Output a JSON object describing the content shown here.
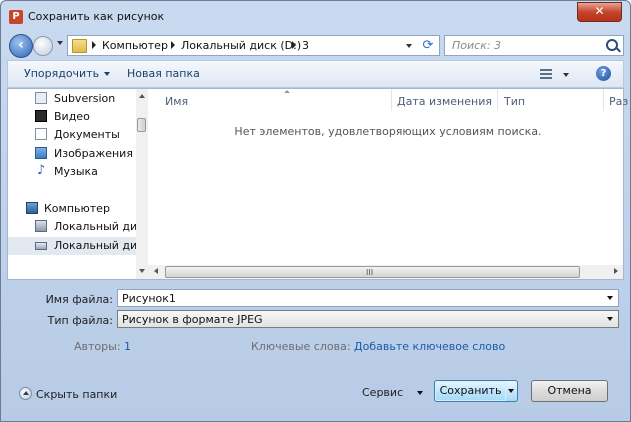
{
  "window": {
    "title": "Сохранить как рисунок",
    "app_icon": "P",
    "close_glyph": "✕"
  },
  "address": {
    "crumbs": [
      "Компьютер",
      "Локальный диск (D:)",
      "3"
    ]
  },
  "search": {
    "placeholder": "Поиск: 3"
  },
  "toolbar": {
    "organize_label": "Упорядочить",
    "new_folder_label": "Новая папка",
    "help_glyph": "?"
  },
  "nav": {
    "items": [
      {
        "label": "Subversion",
        "icon": "subversion-icon"
      },
      {
        "label": "Видео",
        "icon": "video-icon"
      },
      {
        "label": "Документы",
        "icon": "documents-icon"
      },
      {
        "label": "Изображения",
        "icon": "pictures-icon"
      },
      {
        "label": "Музыка",
        "icon": "music-icon"
      },
      {
        "label": "Компьютер",
        "icon": "computer-icon"
      },
      {
        "label": "Локальный диск",
        "icon": "drive-c-icon"
      },
      {
        "label": "Локальный диск",
        "icon": "drive-d-icon",
        "selected": true
      }
    ]
  },
  "columns": [
    "Имя",
    "Дата изменения",
    "Тип",
    "Раз"
  ],
  "empty_message": "Нет элементов, удовлетворяющих условиям поиска.",
  "scrollbar_grip": "III",
  "form": {
    "filename_label": "Имя файла:",
    "filename_value": "Рисунок1",
    "filetype_label": "Тип файла:",
    "filetype_value": "Рисунок в формате JPEG",
    "authors_label": "Авторы:",
    "authors_value": "1",
    "keywords_label": "Ключевые слова:",
    "keywords_value": "Добавьте ключевое слово"
  },
  "footer": {
    "hide_folders_label": "Скрыть папки",
    "service_label": "Сервис",
    "save_label": "Сохранить",
    "cancel_label": "Отмена"
  },
  "colors": {
    "accent": "#1f5aa8",
    "frame": "#b7cbe6",
    "close": "#c5442c",
    "primary_button": "#bee6fd"
  }
}
